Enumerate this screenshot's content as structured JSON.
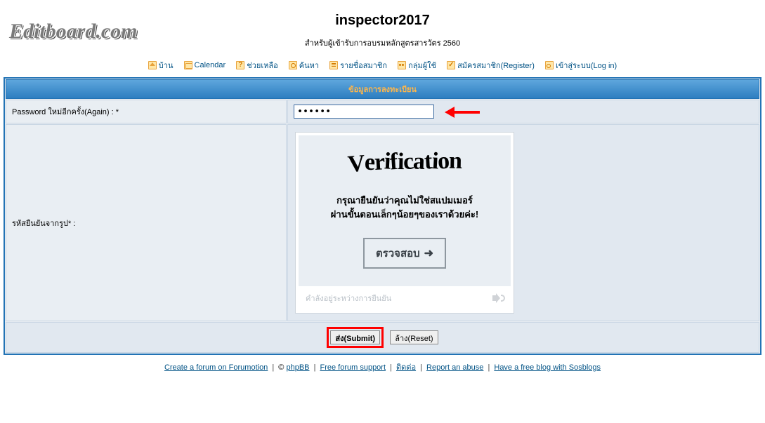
{
  "header": {
    "logo_text": "Editboard.com",
    "site_title": "inspector2017",
    "site_subtitle": "สำหรับผู้เข้ารับการอบรมหลักสูตรสารวัตร 2560"
  },
  "nav": {
    "home": "บ้าน",
    "calendar": "Calendar",
    "help": "ช่วยเหลือ",
    "search": "ค้นหา",
    "members": "รายชื่อสมาชิก",
    "groups": "กลุ่มผู้ใช้",
    "register": "สมัครสมาชิก(Register)",
    "login": "เข้าสู่ระบบ(Log in)"
  },
  "form": {
    "section_title": "ข้อมูลการลงทะเบียน",
    "password_again_label": "Password ใหม่อีกครั้ง(Again) : *",
    "password_value": "••••••",
    "captcha_label": "รหัสยืนยันจากรูป* :",
    "verification": {
      "title": "Verification",
      "line1": "กรุณายืนยันว่าคุณไม่ใช่สแปมเมอร์",
      "line2": "ผ่านขั้นตอนเล็กๆน้อยๆของเราด้วยค่ะ!",
      "check_button": "ตรวจสอบ",
      "footer_hint": "คำลังอยู่ระหว่างการยืนยัน"
    },
    "submit_label": "ส่ง(Submit)",
    "reset_label": "ล้าง(Reset)"
  },
  "footer": {
    "create_forum": "Create a forum on Forumotion",
    "copyright": "©",
    "phpbb": "phpBB",
    "free_support": "Free forum support",
    "contact": "ติดต่อ",
    "report": "Report an abuse",
    "sosblogs": "Have a free blog with Sosblogs"
  }
}
